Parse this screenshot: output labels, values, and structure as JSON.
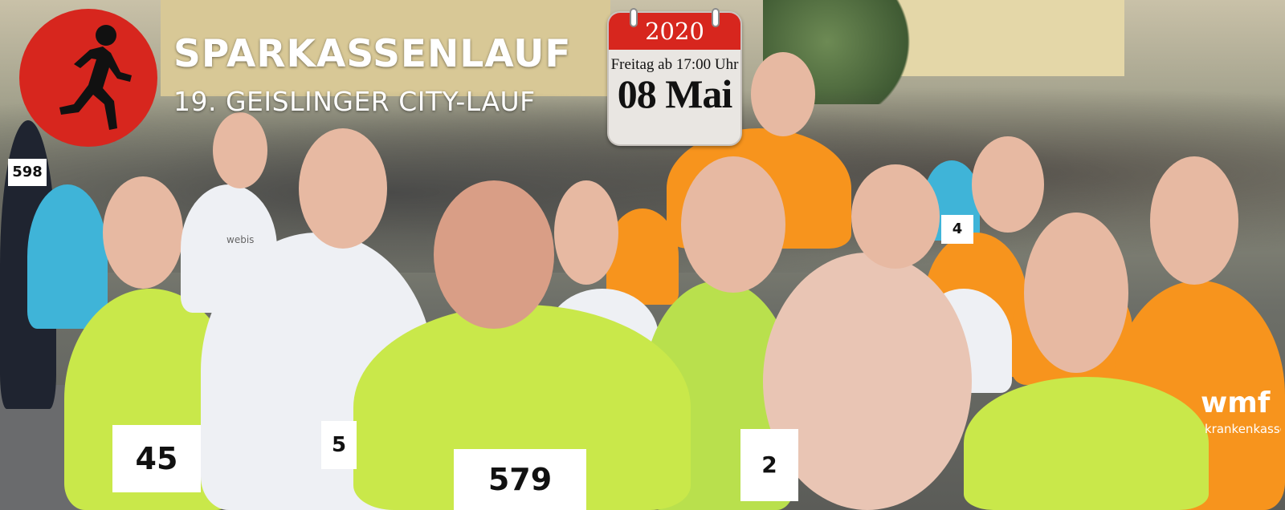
{
  "event": {
    "title": "SPARKASSENLAUF",
    "subtitle": "19. GEISLINGER CITY-LAUF"
  },
  "calendar": {
    "year": "2020",
    "time_text": "Freitag ab 17:00 Uhr",
    "date_text": "08 Mai"
  },
  "photo": {
    "bib_numbers": [
      "598",
      "45",
      "5",
      "579",
      "2",
      "4"
    ],
    "shirt_texts": [
      "wmf",
      "krankenkasse",
      "webis"
    ]
  },
  "colors": {
    "brand_red": "#d7261e",
    "white": "#ffffff",
    "lime": "#c9e84a",
    "orange": "#f7941d"
  },
  "icons": {
    "logo": "running-man-icon"
  }
}
